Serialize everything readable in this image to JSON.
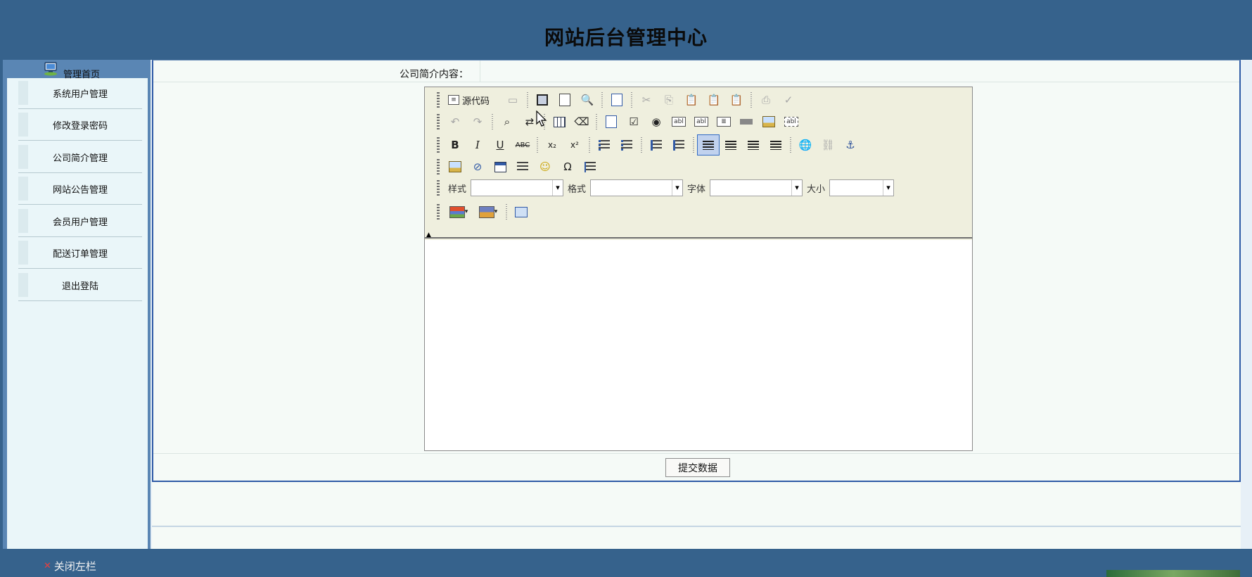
{
  "header": {
    "title": "网站后台管理中心"
  },
  "sidebar": {
    "home_label": "管理首页",
    "items": [
      {
        "label": "系统用户管理"
      },
      {
        "label": "修改登录密码"
      },
      {
        "label": "公司简介管理"
      },
      {
        "label": "网站公告管理"
      },
      {
        "label": "会员用户管理"
      },
      {
        "label": "配送订单管理"
      },
      {
        "label": "退出登陆"
      }
    ]
  },
  "form": {
    "content_label": "公司简介内容：",
    "submit_label": "提交数据"
  },
  "editor": {
    "source_label": "源代码",
    "style_label": "样式",
    "format_label": "格式",
    "font_label": "字体",
    "size_label": "大小",
    "style_value": "",
    "format_value": "",
    "font_value": "",
    "size_value": "",
    "content": ""
  },
  "footer": {
    "close_sidebar_label": "关闭左栏"
  },
  "colors": {
    "header_bg": "#36628c",
    "sidebar_bg": "#eaf6f9",
    "content_bg": "#f5faf7",
    "toolbar_bg": "#efefde",
    "form_border": "#2e5aa6"
  }
}
